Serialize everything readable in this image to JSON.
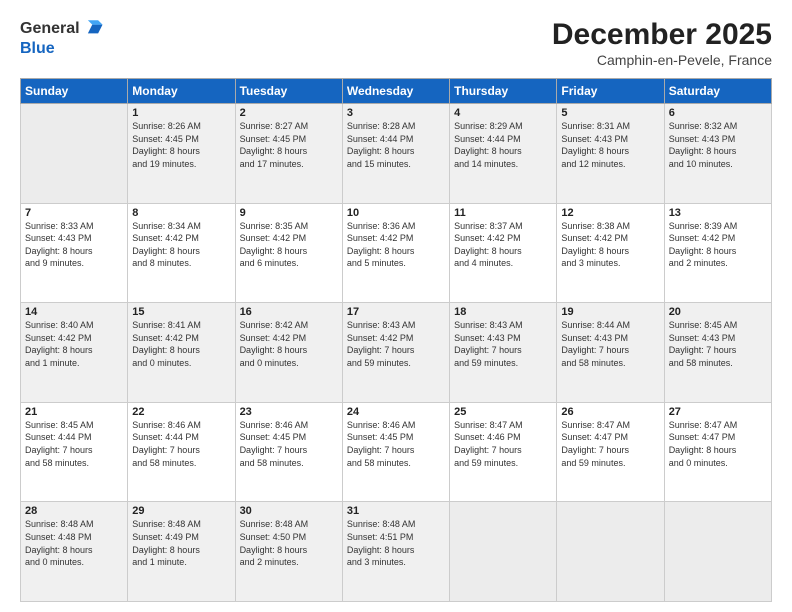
{
  "header": {
    "logo_general": "General",
    "logo_blue": "Blue",
    "month_title": "December 2025",
    "subtitle": "Camphin-en-Pevele, France"
  },
  "days_of_week": [
    "Sunday",
    "Monday",
    "Tuesday",
    "Wednesday",
    "Thursday",
    "Friday",
    "Saturday"
  ],
  "weeks": [
    [
      {
        "day": "",
        "info": ""
      },
      {
        "day": "1",
        "info": "Sunrise: 8:26 AM\nSunset: 4:45 PM\nDaylight: 8 hours\nand 19 minutes."
      },
      {
        "day": "2",
        "info": "Sunrise: 8:27 AM\nSunset: 4:45 PM\nDaylight: 8 hours\nand 17 minutes."
      },
      {
        "day": "3",
        "info": "Sunrise: 8:28 AM\nSunset: 4:44 PM\nDaylight: 8 hours\nand 15 minutes."
      },
      {
        "day": "4",
        "info": "Sunrise: 8:29 AM\nSunset: 4:44 PM\nDaylight: 8 hours\nand 14 minutes."
      },
      {
        "day": "5",
        "info": "Sunrise: 8:31 AM\nSunset: 4:43 PM\nDaylight: 8 hours\nand 12 minutes."
      },
      {
        "day": "6",
        "info": "Sunrise: 8:32 AM\nSunset: 4:43 PM\nDaylight: 8 hours\nand 10 minutes."
      }
    ],
    [
      {
        "day": "7",
        "info": "Sunrise: 8:33 AM\nSunset: 4:43 PM\nDaylight: 8 hours\nand 9 minutes."
      },
      {
        "day": "8",
        "info": "Sunrise: 8:34 AM\nSunset: 4:42 PM\nDaylight: 8 hours\nand 8 minutes."
      },
      {
        "day": "9",
        "info": "Sunrise: 8:35 AM\nSunset: 4:42 PM\nDaylight: 8 hours\nand 6 minutes."
      },
      {
        "day": "10",
        "info": "Sunrise: 8:36 AM\nSunset: 4:42 PM\nDaylight: 8 hours\nand 5 minutes."
      },
      {
        "day": "11",
        "info": "Sunrise: 8:37 AM\nSunset: 4:42 PM\nDaylight: 8 hours\nand 4 minutes."
      },
      {
        "day": "12",
        "info": "Sunrise: 8:38 AM\nSunset: 4:42 PM\nDaylight: 8 hours\nand 3 minutes."
      },
      {
        "day": "13",
        "info": "Sunrise: 8:39 AM\nSunset: 4:42 PM\nDaylight: 8 hours\nand 2 minutes."
      }
    ],
    [
      {
        "day": "14",
        "info": "Sunrise: 8:40 AM\nSunset: 4:42 PM\nDaylight: 8 hours\nand 1 minute."
      },
      {
        "day": "15",
        "info": "Sunrise: 8:41 AM\nSunset: 4:42 PM\nDaylight: 8 hours\nand 0 minutes."
      },
      {
        "day": "16",
        "info": "Sunrise: 8:42 AM\nSunset: 4:42 PM\nDaylight: 8 hours\nand 0 minutes."
      },
      {
        "day": "17",
        "info": "Sunrise: 8:43 AM\nSunset: 4:42 PM\nDaylight: 7 hours\nand 59 minutes."
      },
      {
        "day": "18",
        "info": "Sunrise: 8:43 AM\nSunset: 4:43 PM\nDaylight: 7 hours\nand 59 minutes."
      },
      {
        "day": "19",
        "info": "Sunrise: 8:44 AM\nSunset: 4:43 PM\nDaylight: 7 hours\nand 58 minutes."
      },
      {
        "day": "20",
        "info": "Sunrise: 8:45 AM\nSunset: 4:43 PM\nDaylight: 7 hours\nand 58 minutes."
      }
    ],
    [
      {
        "day": "21",
        "info": "Sunrise: 8:45 AM\nSunset: 4:44 PM\nDaylight: 7 hours\nand 58 minutes."
      },
      {
        "day": "22",
        "info": "Sunrise: 8:46 AM\nSunset: 4:44 PM\nDaylight: 7 hours\nand 58 minutes."
      },
      {
        "day": "23",
        "info": "Sunrise: 8:46 AM\nSunset: 4:45 PM\nDaylight: 7 hours\nand 58 minutes."
      },
      {
        "day": "24",
        "info": "Sunrise: 8:46 AM\nSunset: 4:45 PM\nDaylight: 7 hours\nand 58 minutes."
      },
      {
        "day": "25",
        "info": "Sunrise: 8:47 AM\nSunset: 4:46 PM\nDaylight: 7 hours\nand 59 minutes."
      },
      {
        "day": "26",
        "info": "Sunrise: 8:47 AM\nSunset: 4:47 PM\nDaylight: 7 hours\nand 59 minutes."
      },
      {
        "day": "27",
        "info": "Sunrise: 8:47 AM\nSunset: 4:47 PM\nDaylight: 8 hours\nand 0 minutes."
      }
    ],
    [
      {
        "day": "28",
        "info": "Sunrise: 8:48 AM\nSunset: 4:48 PM\nDaylight: 8 hours\nand 0 minutes."
      },
      {
        "day": "29",
        "info": "Sunrise: 8:48 AM\nSunset: 4:49 PM\nDaylight: 8 hours\nand 1 minute."
      },
      {
        "day": "30",
        "info": "Sunrise: 8:48 AM\nSunset: 4:50 PM\nDaylight: 8 hours\nand 2 minutes."
      },
      {
        "day": "31",
        "info": "Sunrise: 8:48 AM\nSunset: 4:51 PM\nDaylight: 8 hours\nand 3 minutes."
      },
      {
        "day": "",
        "info": ""
      },
      {
        "day": "",
        "info": ""
      },
      {
        "day": "",
        "info": ""
      }
    ]
  ]
}
